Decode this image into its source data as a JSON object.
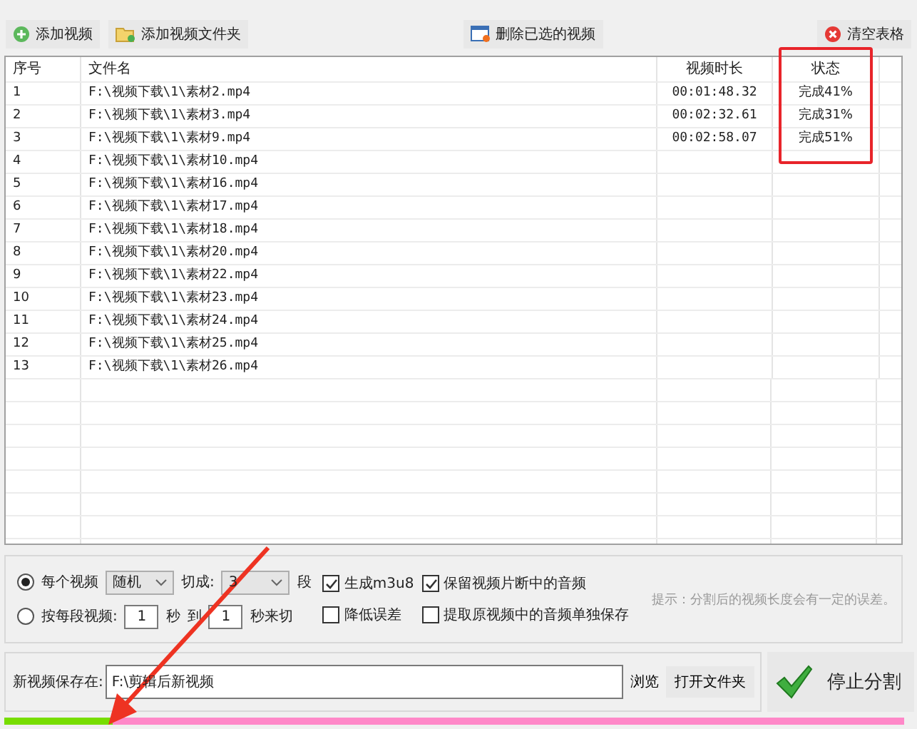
{
  "toolbar": [
    {
      "kind": "add",
      "label": "添加视频"
    },
    {
      "kind": "folder",
      "label": "添加视频文件夹"
    },
    {
      "kind": "delete",
      "label": "删除已选的视频"
    },
    {
      "kind": "clear",
      "label": "清空表格"
    }
  ],
  "table": {
    "columns": [
      "序号",
      "文件名",
      "视频时长",
      "状态"
    ],
    "rows": [
      [
        "1",
        "F:\\视频下载\\1\\素材2.mp4",
        "00:01:48.32",
        "完成41%"
      ],
      [
        "2",
        "F:\\视频下载\\1\\素材3.mp4",
        "00:02:32.61",
        "完成31%"
      ],
      [
        "3",
        "F:\\视频下载\\1\\素材9.mp4",
        "00:02:58.07",
        "完成51%"
      ],
      [
        "4",
        "F:\\视频下载\\1\\素材10.mp4",
        "",
        ""
      ],
      [
        "5",
        "F:\\视频下载\\1\\素材16.mp4",
        "",
        ""
      ],
      [
        "6",
        "F:\\视频下载\\1\\素材17.mp4",
        "",
        ""
      ],
      [
        "7",
        "F:\\视频下载\\1\\素材18.mp4",
        "",
        ""
      ],
      [
        "8",
        "F:\\视频下载\\1\\素材20.mp4",
        "",
        ""
      ],
      [
        "9",
        "F:\\视频下载\\1\\素材22.mp4",
        "",
        ""
      ],
      [
        "10",
        "F:\\视频下载\\1\\素材23.mp4",
        "",
        ""
      ],
      [
        "11",
        "F:\\视频下载\\1\\素材24.mp4",
        "",
        ""
      ],
      [
        "12",
        "F:\\视频下载\\1\\素材25.mp4",
        "",
        ""
      ],
      [
        "13",
        "F:\\视频下载\\1\\素材26.mp4",
        "",
        ""
      ]
    ]
  },
  "options": {
    "mode1": {
      "label": "每个视频",
      "selected": true,
      "select": "随机",
      "cut_label": "切成:",
      "count": "3",
      "unit": "段"
    },
    "mode2": {
      "label": "按每段视频:",
      "selected": false,
      "from": "1",
      "sec": "秒",
      "to_label": "到",
      "to": "1",
      "tail": "秒来切"
    },
    "checks": [
      {
        "label": "生成m3u8",
        "checked": true
      },
      {
        "label": "保留视频片断中的音频",
        "checked": true
      },
      {
        "label": "降低误差",
        "checked": false
      },
      {
        "label": "提取原视频中的音频单独保存",
        "checked": false
      }
    ],
    "hint": "提示：分割后的视频长度会有一定的误差。"
  },
  "save": {
    "label": "新视频保存在:",
    "value": "F:\\剪辑后新视频",
    "browse": "浏览",
    "open": "打开文件夹"
  },
  "stop_button": "停止分割",
  "progress": {
    "level": 0.12
  }
}
